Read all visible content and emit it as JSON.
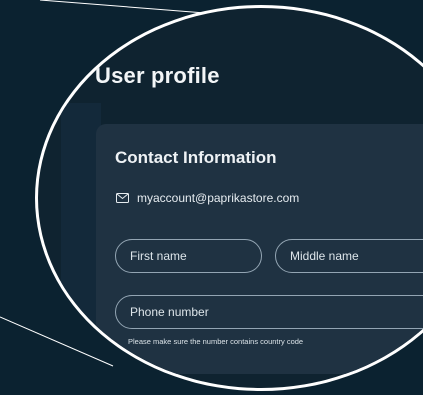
{
  "page": {
    "title": "User profile"
  },
  "contact": {
    "heading": "Contact Information",
    "email": "myaccount@paprikastore.com",
    "email_icon": "mail-icon"
  },
  "form": {
    "first_name_placeholder": "First name",
    "middle_name_placeholder": "Middle name",
    "phone_placeholder": "Phone number",
    "phone_helper": "Please make sure the number contains country code"
  },
  "colors": {
    "background": "#0b2230",
    "card": "#1f3242",
    "ring": "#ffffff",
    "field_border": "#93a5b3"
  }
}
